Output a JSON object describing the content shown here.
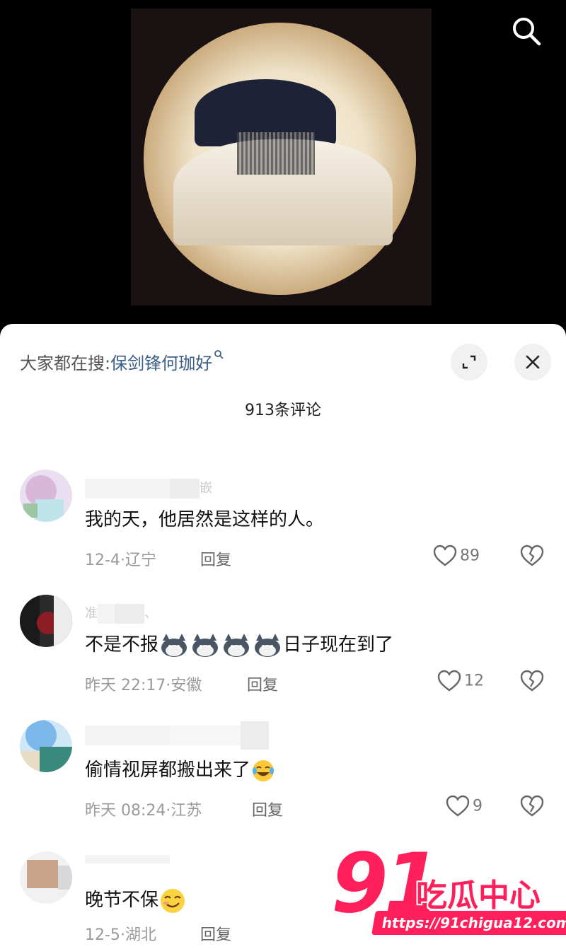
{
  "search_bar": {
    "prefix": "大家都在搜:",
    "keyword": "保剑锋何珈好"
  },
  "comment_count": "913条评论",
  "comments": [
    {
      "username_partial": "嵌",
      "text": "我的天，他居然是这样的人。",
      "date": "12-4",
      "location": "辽宁",
      "reply": "回复",
      "likes": "89"
    },
    {
      "username_partial": "准",
      "text_before": "不是不报",
      "text_after": "日子现在到了",
      "date": "昨天 22:17",
      "location": "安徽",
      "reply": "回复",
      "likes": "12"
    },
    {
      "username_partial": "",
      "text": "偷情视屏都搬出来了",
      "date": "昨天 08:24",
      "location": "江苏",
      "reply": "回复",
      "likes": "9"
    },
    {
      "username_partial": "",
      "text": "晚节不保",
      "date": "12-5",
      "location": "湖北",
      "reply": "回复",
      "likes": ""
    }
  ],
  "watermark": {
    "number": "91",
    "name": "吃瓜中心",
    "url": "https://91chigua12.com"
  },
  "colors": {
    "accent_link": "#3a5e88",
    "watermark": "#ff1f5a"
  }
}
